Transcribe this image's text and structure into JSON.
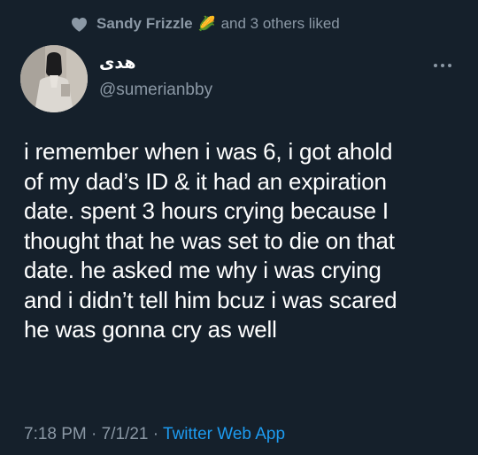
{
  "social_context": {
    "icon": "heart-icon",
    "liker_name": "Sandy Frizzle",
    "liker_emoji": "🌽",
    "suffix": "and 3 others liked"
  },
  "author": {
    "display_name": "هدى",
    "handle": "@sumerianbby",
    "avatar": "profile-photo"
  },
  "more_menu": {
    "icon": "more-horizontal-icon"
  },
  "tweet": {
    "lines": [
      "i remember when i was 6, i got ahold",
      "of my dad’s ID & it had an expiration",
      "date. spent 3 hours crying because I",
      "thought that he was set to die on that",
      "date. he asked me why i was crying",
      "and i didn’t tell him bcuz i was scared",
      "he was gonna cry as well"
    ]
  },
  "meta": {
    "time": "7:18 PM",
    "separator": "·",
    "date": "7/1/21",
    "source": "Twitter Web App"
  },
  "colors": {
    "background": "#15202b",
    "text": "#ffffff",
    "secondary_text": "#8b98a5",
    "link": "#1d9bf0"
  }
}
